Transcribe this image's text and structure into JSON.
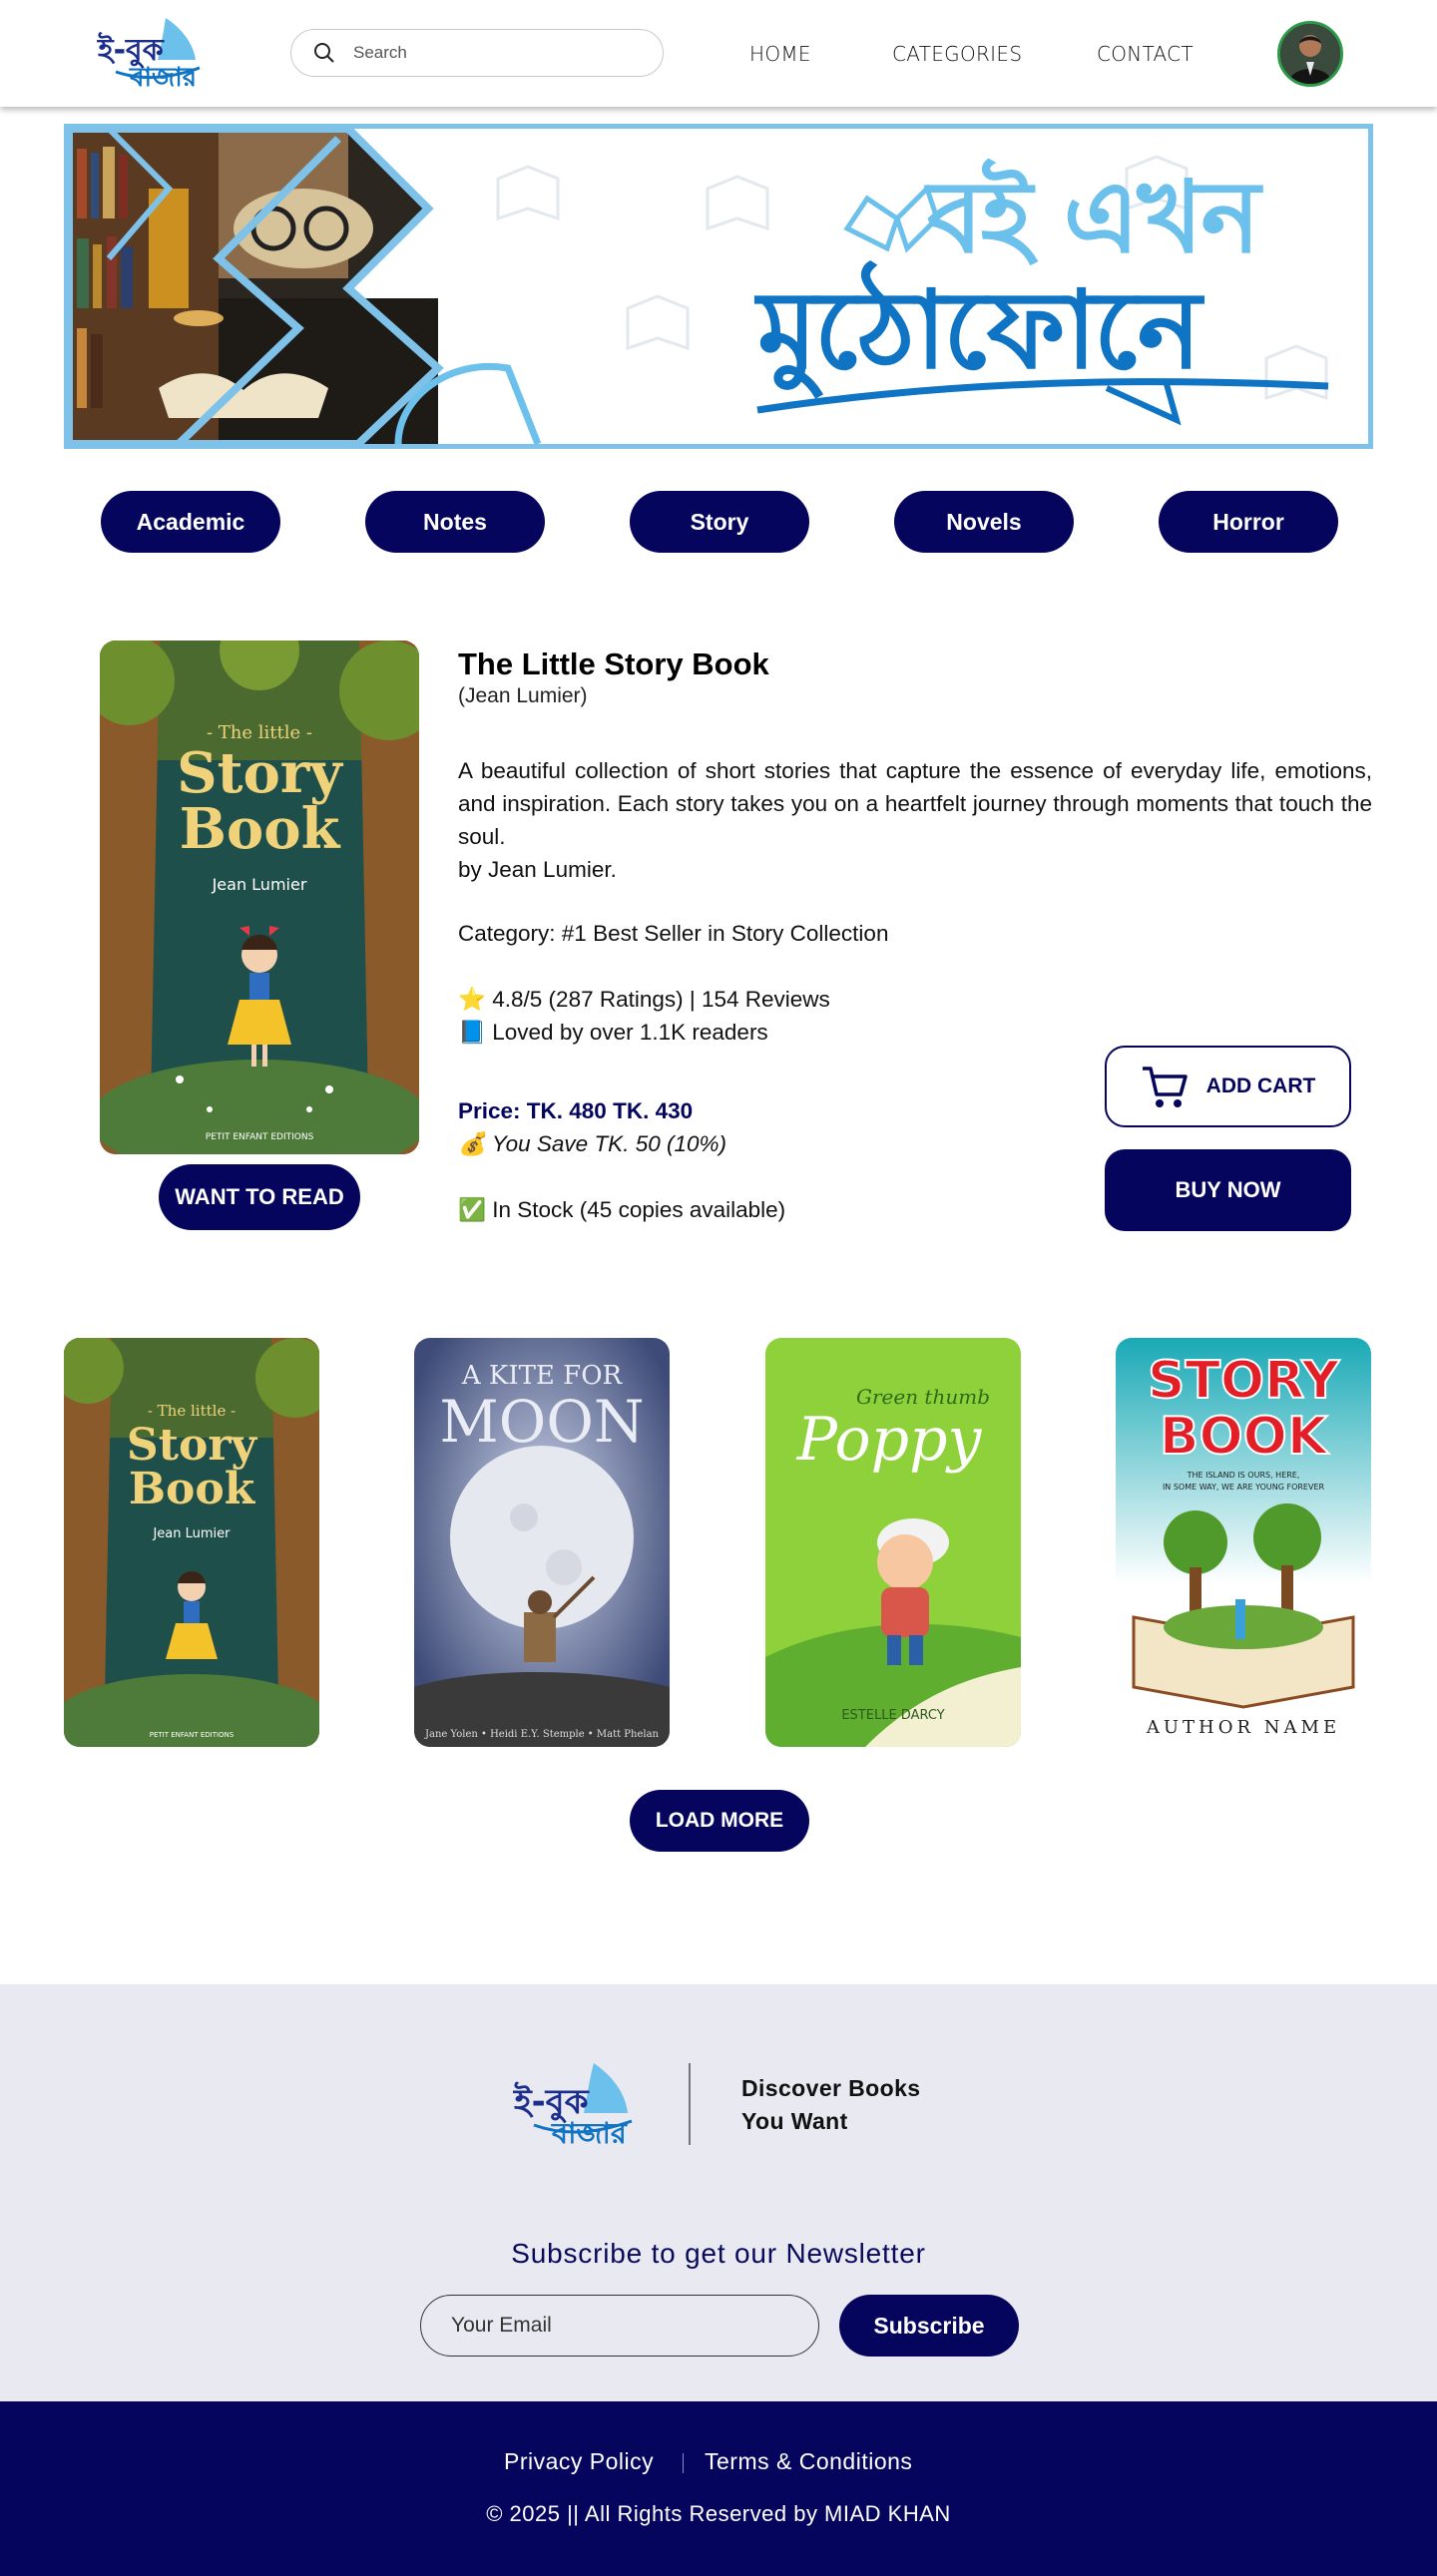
{
  "header": {
    "logo_text": "ই-বুক বাজার",
    "search_placeholder": "Search",
    "nav": [
      "HOME",
      "CATEGORIES",
      "CONTACT"
    ]
  },
  "banner": {
    "line1": "বই এখন",
    "line2": "মুঠোফোনে"
  },
  "categories": [
    "Academic",
    "Notes",
    "Story",
    "Novels",
    "Horror"
  ],
  "featured": {
    "title": "The Little Story Book",
    "author": "(Jean Lumier)",
    "description": "A beautiful collection of short stories that capture the essence of everyday life, emotions, and inspiration. Each story takes you on a heartfelt journey through moments that touch the soul.",
    "by_line": "by Jean Lumier.",
    "category": "Category: #1 Best Seller in Story Collection",
    "rating": "⭐ 4.8/5 (287 Ratings) | 154 Reviews",
    "readers": "📘 Loved by over 1.1K readers",
    "price": "Price: TK. 480 TK. 430",
    "save": "💰 You Save TK. 50 (10%)",
    "stock": "✅ In Stock (45 copies available)",
    "want_to_read": "WANT TO READ",
    "add_cart": "ADD CART",
    "buy_now": "BUY NOW",
    "cover": {
      "title_small": "- The little -",
      "title_big1": "Story",
      "title_big2": "Book",
      "author": "Jean Lumier",
      "publisher": "PETIT ENFANT EDITIONS"
    }
  },
  "grid": {
    "book2": {
      "line1": "A KITE FOR",
      "line2": "MOON",
      "authors": "Jane Yolen • Heidi E.Y. Stemple • Matt Phelan"
    },
    "book3": {
      "subtitle": "Green thumb",
      "title": "Poppy",
      "author": "ESTELLE DARCY"
    },
    "book4": {
      "line1": "STORY",
      "line2": "BOOK",
      "tagline1": "THE ISLAND IS OURS, HERE,",
      "tagline2": "IN SOME WAY, WE ARE YOUNG FOREVER",
      "author": "AUTHOR NAME"
    },
    "load_more": "LOAD MORE"
  },
  "footer": {
    "tagline1": "Discover Books",
    "tagline2": "You Want",
    "newsletter_title": "Subscribe to get our Newsletter",
    "email_placeholder": "Your Email",
    "subscribe": "Subscribe",
    "privacy": "Privacy Policy",
    "terms": "Terms & Conditions",
    "copyright": "© 2025 || All Rights Reserved by MIAD KHAN"
  },
  "colors": {
    "primary": "#05055e",
    "banner_light": "#6cc0ec",
    "banner_dark": "#0f74c3",
    "footer_bg": "#e9e9f1"
  }
}
